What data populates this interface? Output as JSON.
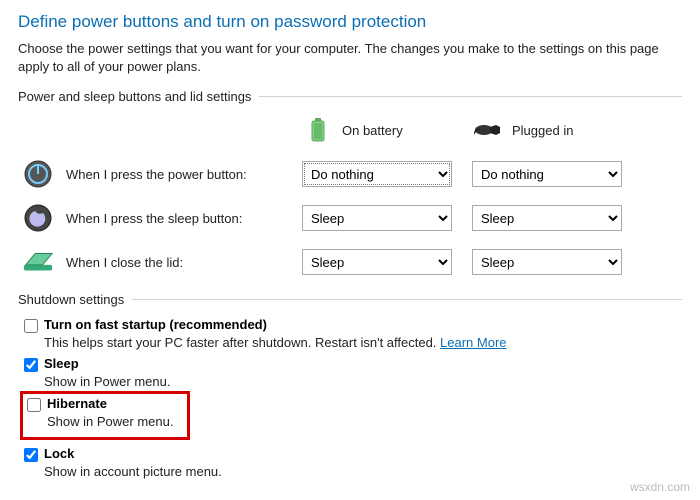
{
  "title": "Define power buttons and turn on password protection",
  "subtitle": "Choose the power settings that you want for your computer. The changes you make to the settings on this page apply to all of your power plans.",
  "section_buttons": "Power and sleep buttons and lid settings",
  "headers": {
    "battery": "On battery",
    "plugged": "Plugged in"
  },
  "rows": {
    "power": {
      "label": "When I press the power button:",
      "battery": "Do nothing",
      "plugged": "Do nothing"
    },
    "sleep": {
      "label": "When I press the sleep button:",
      "battery": "Sleep",
      "plugged": "Sleep"
    },
    "lid": {
      "label": "When I close the lid:",
      "battery": "Sleep",
      "plugged": "Sleep"
    }
  },
  "section_shutdown": "Shutdown settings",
  "shutdown": {
    "fast": {
      "title": "Turn on fast startup (recommended)",
      "desc_pre": "This helps start your PC faster after shutdown. Restart isn't affected. ",
      "link": "Learn More"
    },
    "sleep": {
      "title": "Sleep",
      "desc": "Show in Power menu."
    },
    "hibernate": {
      "title": "Hibernate",
      "desc": "Show in Power menu."
    },
    "lock": {
      "title": "Lock",
      "desc": "Show in account picture menu."
    }
  },
  "watermark": "wsxdn.com"
}
